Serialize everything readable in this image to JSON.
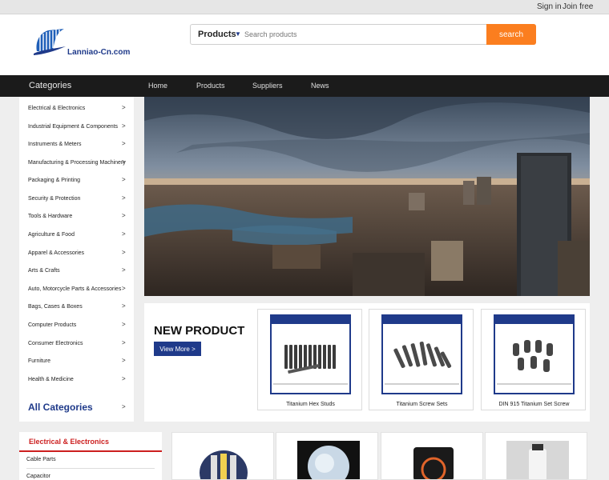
{
  "topbar": {
    "sign_in": "Sign in",
    "join_free": "Join free"
  },
  "logo": {
    "text": "Lanniao-Cn.com"
  },
  "search": {
    "category": "Products",
    "placeholder": "Search products",
    "button": "search"
  },
  "nav": {
    "categories_label": "Categories",
    "links": [
      "Home",
      "Products",
      "Suppliers",
      "News"
    ]
  },
  "sidebar": {
    "items": [
      "Electrical & Electronics",
      "Industrial Equipment & Components",
      "Instruments & Meters",
      "Manufacturing & Processing Machinery",
      "Packaging & Printing",
      "Security & Protection",
      "Tools & Hardware",
      "Agriculture & Food",
      "Apparel & Accessories",
      "Arts & Crafts",
      "Auto, Motorcycle Parts & Accessories",
      "Bags, Cases & Boxes",
      "Computer Products",
      "Consumer Electronics",
      "Furniture",
      "Health & Medicine"
    ],
    "arrow": ">",
    "all_categories": "All Categories"
  },
  "new_product": {
    "title": "NEW PRODUCT",
    "button": "View More >",
    "products": [
      "Titanium Hex Studs",
      "Titanium Screw Sets",
      "DIN 915 Titanium Set Screw"
    ]
  },
  "category_panel": {
    "title": "Electrical & Electronics",
    "items": [
      "Cable Parts",
      "Capacitor"
    ]
  },
  "colors": {
    "brand": "#1f3a8a",
    "accent": "#fb7e1f",
    "highlight": "#cc1f1f",
    "navbar": "#1b1b1b"
  },
  "icons": {
    "search_dropdown": "caret-down-icon",
    "logo": "globe-stripes-icon"
  }
}
